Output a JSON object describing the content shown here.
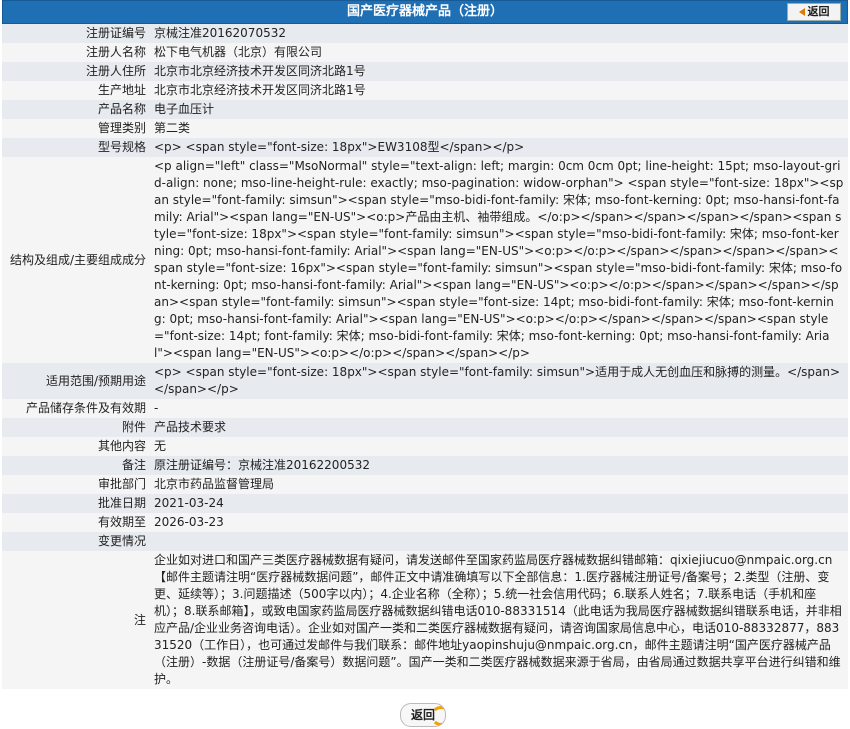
{
  "header": {
    "title": "国产医疗器械产品（注册）",
    "back_label": "返回"
  },
  "rows": [
    {
      "key": "注册证编号",
      "value": "京械注准20162070532"
    },
    {
      "key": "注册人名称",
      "value": "松下电气机器（北京）有限公司"
    },
    {
      "key": "注册人住所",
      "value": "北京市北京经济技术开发区同济北路1号"
    },
    {
      "key": "生产地址",
      "value": "北京市北京经济技术开发区同济北路1号"
    },
    {
      "key": "产品名称",
      "value": "电子血压计"
    },
    {
      "key": "管理类别",
      "value": "第二类"
    },
    {
      "key": "型号规格",
      "value": "<p> <span style=\"font-size: 18px\">EW3108型</span></p>"
    },
    {
      "key": "结构及组成/主要组成成分",
      "value": "<p align=\"left\" class=\"MsoNormal\" style=\"text-align: left; margin: 0cm 0cm 0pt; line-height: 15pt; mso-layout-grid-align: none; mso-line-height-rule: exactly; mso-pagination: widow-orphan\"> <span style=\"font-size: 18px\"><span style=\"font-family: simsun\"><span style=\"mso-bidi-font-family: 宋体; mso-font-kerning: 0pt; mso-hansi-font-family: Arial\"><span lang=\"EN-US\"><o:p>产品由主机、袖带组成。</o:p></span></span></span></span><span style=\"font-size: 18px\"><span style=\"font-family: simsun\"><span style=\"mso-bidi-font-family: 宋体; mso-font-kerning: 0pt; mso-hansi-font-family: Arial\"><span lang=\"EN-US\"><o:p></o:p></span></span></span></span><span style=\"font-size: 16px\"><span style=\"font-family: simsun\"><span style=\"mso-bidi-font-family: 宋体; mso-font-kerning: 0pt; mso-hansi-font-family: Arial\"><span lang=\"EN-US\"><o:p></o:p></span></span></span></span><span style=\"font-family: simsun\"><span style=\"font-size: 14pt; mso-bidi-font-family: 宋体; mso-font-kerning: 0pt; mso-hansi-font-family: Arial\"><span lang=\"EN-US\"><o:p></o:p></span></span></span><span style=\"font-size: 14pt; font-family: 宋体; mso-bidi-font-family: 宋体; mso-font-kerning: 0pt; mso-hansi-font-family: Arial\"><span lang=\"EN-US\"><o:p></o:p></span></span></p>"
    },
    {
      "key": "适用范围/预期用途",
      "value": "<p> <span style=\"font-size: 18px\"><span style=\"font-family: simsun\">适用于成人无创血压和脉搏的测量。</span></span></p>"
    },
    {
      "key": "产品储存条件及有效期",
      "value": "-"
    },
    {
      "key": "附件",
      "value": "产品技术要求"
    },
    {
      "key": "其他内容",
      "value": "无"
    },
    {
      "key": "备注",
      "value": "原注册证编号：京械注准20162200532"
    },
    {
      "key": "审批部门",
      "value": "北京市药品监督管理局"
    },
    {
      "key": "批准日期",
      "value": "2021-03-24"
    },
    {
      "key": "有效期至",
      "value": "2026-03-23"
    },
    {
      "key": "变更情况",
      "value": ""
    },
    {
      "key": "注",
      "value": "企业如对进口和国产三类医疗器械数据有疑问，请发送邮件至国家药监局医疗器械数据纠错邮箱：qixiejiucuo@nmpaic.org.cn【邮件主题请注明“医疗器械数据问题”，邮件正文中请准确填写以下全部信息：1.医疗器械注册证号/备案号；2.类型（注册、变更、延续等）；3.问题描述（500字以内）；4.企业名称（全称）；5.统一社会信用代码；6.联系人姓名；7.联系电话（手机和座机）；8.联系邮箱】，或致电国家药监局医疗器械数据纠错电话010-88331514（此电话为我局医疗器械数据纠错联系电话，并非相应产品/企业业务咨询电话）。企业如对国产一类和二类医疗器械数据有疑问，请咨询国家局信息中心，电话010-88332877，88331520（工作日），也可通过发邮件与我们联系：邮件地址yaopinshuju@nmpaic.org.cn，邮件主题请注明“国产医疗器械产品（注册）-数据（注册证号/备案号）数据问题”。国产一类和二类医疗器械数据来源于省局，由省局通过数据共享平台进行纠错和维护。"
    }
  ],
  "footer": {
    "back_label": "返回"
  }
}
